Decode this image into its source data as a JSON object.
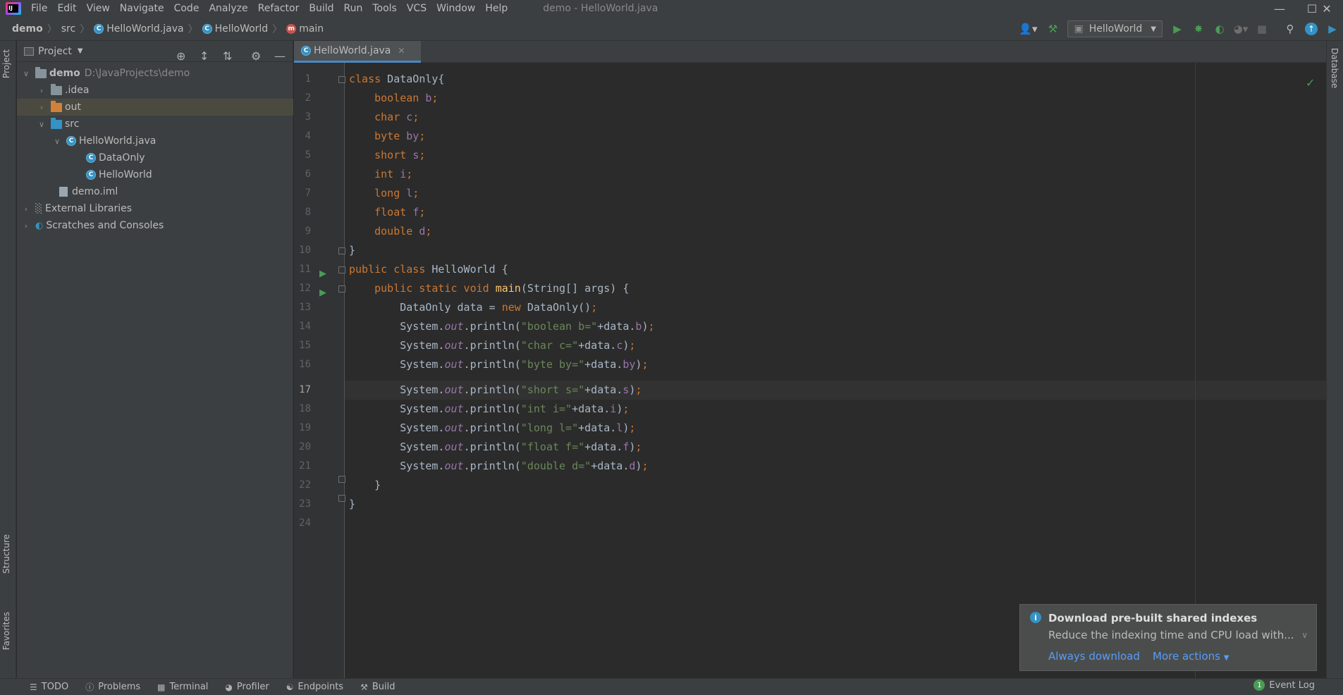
{
  "menubar": {
    "items": [
      "File",
      "Edit",
      "View",
      "Navigate",
      "Code",
      "Analyze",
      "Refactor",
      "Build",
      "Run",
      "Tools",
      "VCS",
      "Window",
      "Help"
    ],
    "window_title": "demo - HelloWorld.java"
  },
  "breadcrumb": {
    "project": "demo",
    "folder": "src",
    "file": "HelloWorld.java",
    "class": "HelloWorld",
    "method": "main"
  },
  "toolbar": {
    "run_config": "HelloWorld"
  },
  "left_strip": {
    "project_tab": "Project",
    "structure_tab": "Structure",
    "favorites_tab": "Favorites"
  },
  "right_strip": {
    "database_tab": "Database"
  },
  "project_panel": {
    "title": "Project",
    "tree": [
      {
        "label": "demo",
        "hint": "D:\\JavaProjects\\demo"
      },
      {
        "label": ".idea"
      },
      {
        "label": "out"
      },
      {
        "label": "src"
      },
      {
        "label": "HelloWorld.java"
      },
      {
        "label": "DataOnly"
      },
      {
        "label": "HelloWorld"
      },
      {
        "label": "demo.iml"
      },
      {
        "label": "External Libraries"
      },
      {
        "label": "Scratches and Consoles"
      }
    ]
  },
  "editor": {
    "tab_label": "HelloWorld.java",
    "current_line": 17,
    "line_numbers": [
      "1",
      "2",
      "3",
      "4",
      "5",
      "6",
      "7",
      "8",
      "9",
      "10",
      "11",
      "12",
      "13",
      "14",
      "15",
      "16",
      "17",
      "18",
      "19",
      "20",
      "21",
      "22",
      "23",
      "24"
    ]
  },
  "bottom_bar": {
    "tabs": [
      "TODO",
      "Problems",
      "Terminal",
      "Profiler",
      "Endpoints",
      "Build"
    ],
    "event_log": "Event Log",
    "event_count": "1"
  },
  "notification": {
    "title": "Download pre-built shared indexes",
    "body": "Reduce the indexing time and CPU load with...",
    "action_primary": "Always download",
    "action_secondary": "More actions"
  }
}
